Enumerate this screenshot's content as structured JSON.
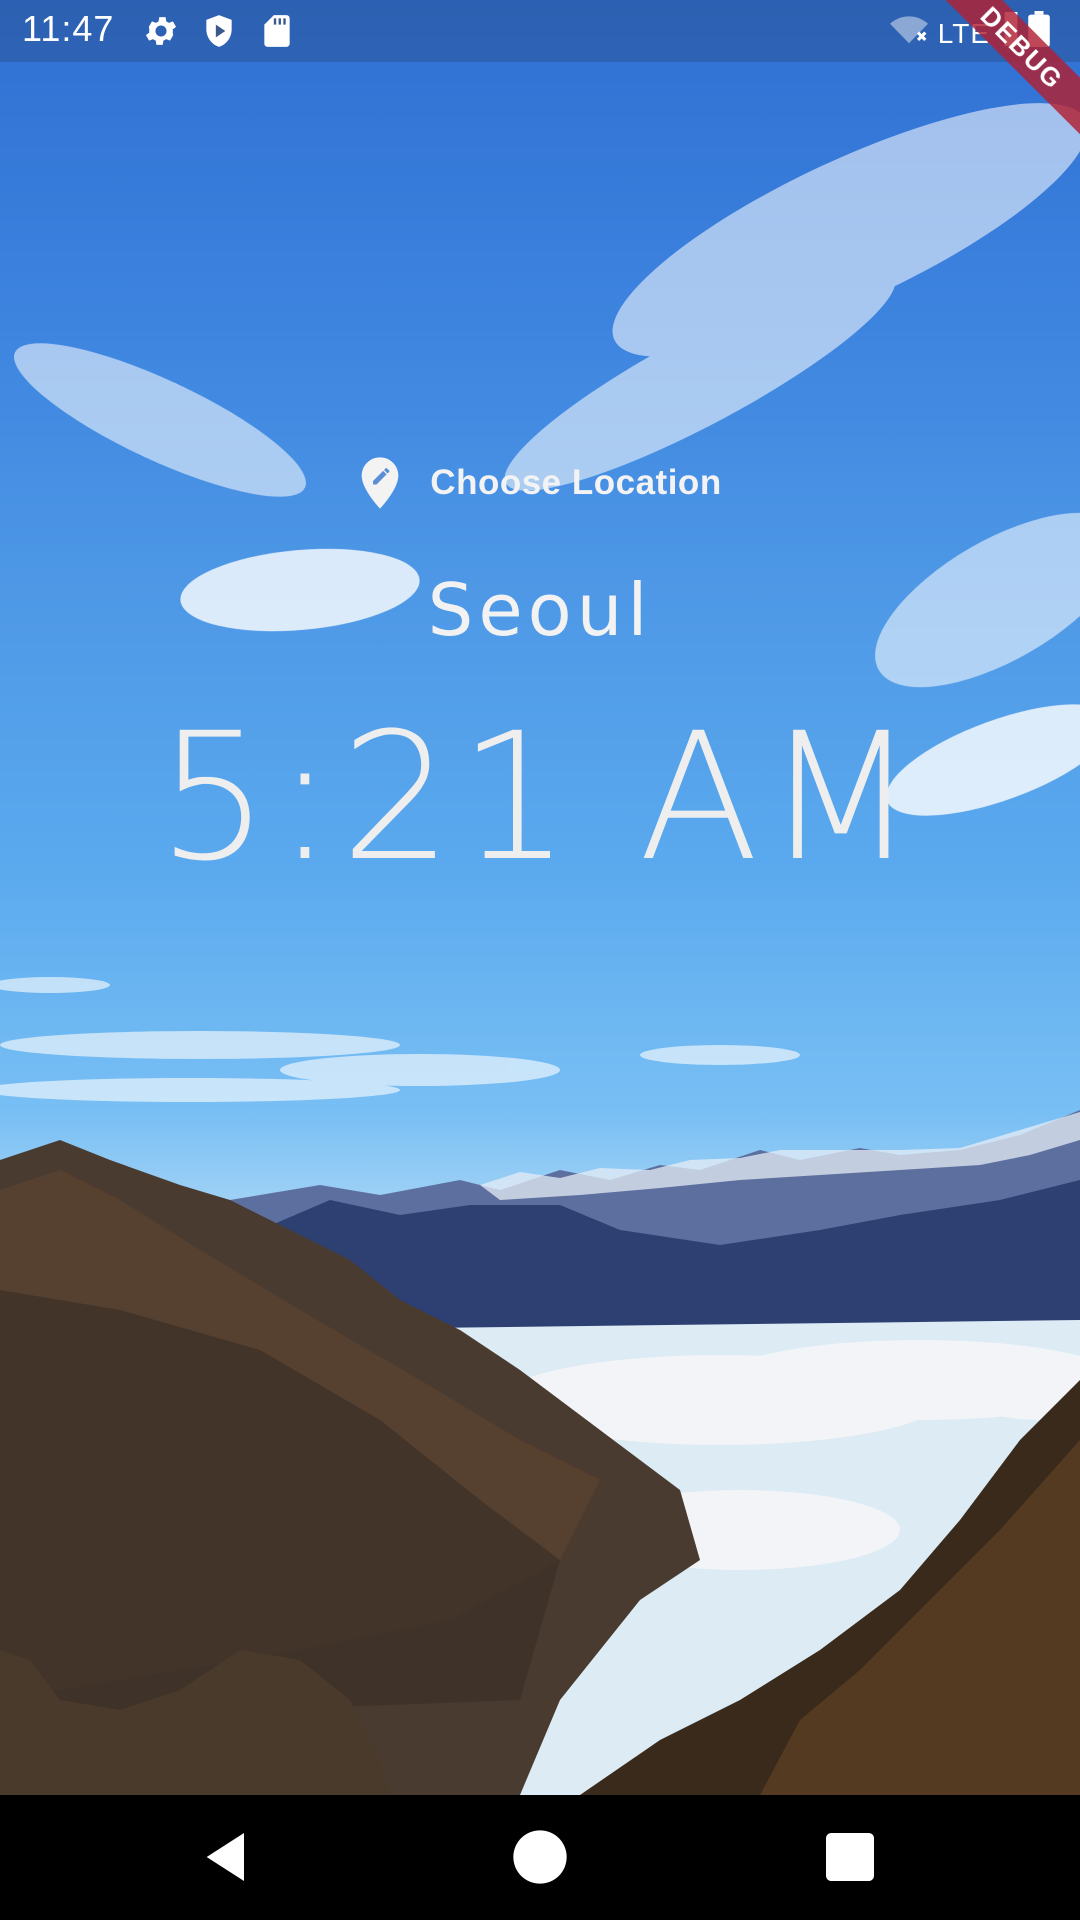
{
  "status_bar": {
    "time": "11:47",
    "network": "LTE",
    "icons": [
      "gear-icon",
      "shield-icon",
      "sd-card-icon",
      "wifi-off-icon",
      "signal-icon",
      "battery-icon"
    ]
  },
  "debug_banner": {
    "label": "DEBUG"
  },
  "location": {
    "button_label": "Choose Location",
    "icon": "edit-location-icon",
    "city": "Seoul",
    "time": "5:21 AM"
  },
  "navigation": {
    "icons": [
      "back-icon",
      "home-icon",
      "recents-icon"
    ]
  },
  "colors": {
    "text": "#f0f0f0",
    "sky_top": "#2f6fd2",
    "sky_bottom": "#dcebf4",
    "debug_ribbon": "#b02032"
  }
}
